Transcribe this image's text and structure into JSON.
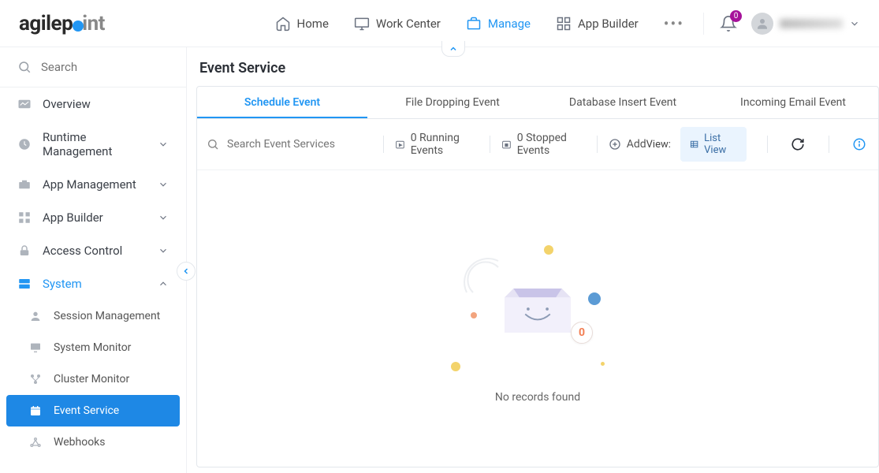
{
  "logo": {
    "text_a": "agilep",
    "text_b": "int"
  },
  "topnav": {
    "items": [
      {
        "label": "Home"
      },
      {
        "label": "Work Center"
      },
      {
        "label": "Manage"
      },
      {
        "label": "App Builder"
      }
    ],
    "notifications_count": "0"
  },
  "sidebar": {
    "search_placeholder": "Search",
    "items": [
      {
        "label": "Overview"
      },
      {
        "label": "Runtime Management"
      },
      {
        "label": "App Management"
      },
      {
        "label": "App Builder"
      },
      {
        "label": "Access Control"
      },
      {
        "label": "System"
      }
    ],
    "system_children": [
      {
        "label": "Session Management"
      },
      {
        "label": "System Monitor"
      },
      {
        "label": "Cluster Monitor"
      },
      {
        "label": "Event Service"
      },
      {
        "label": "Webhooks"
      }
    ]
  },
  "page": {
    "title": "Event Service",
    "tabs": [
      {
        "label": "Schedule Event"
      },
      {
        "label": "File Dropping Event"
      },
      {
        "label": "Database Insert Event"
      },
      {
        "label": "Incoming Email Event"
      }
    ],
    "toolbar": {
      "search_placeholder": "Search Event Services",
      "running_label": "0 Running Events",
      "stopped_label": "0 Stopped Events",
      "add_label": "Add",
      "view_label": "View:",
      "listview_label": "List View"
    },
    "empty": {
      "count": "0",
      "text": "No records found"
    }
  }
}
